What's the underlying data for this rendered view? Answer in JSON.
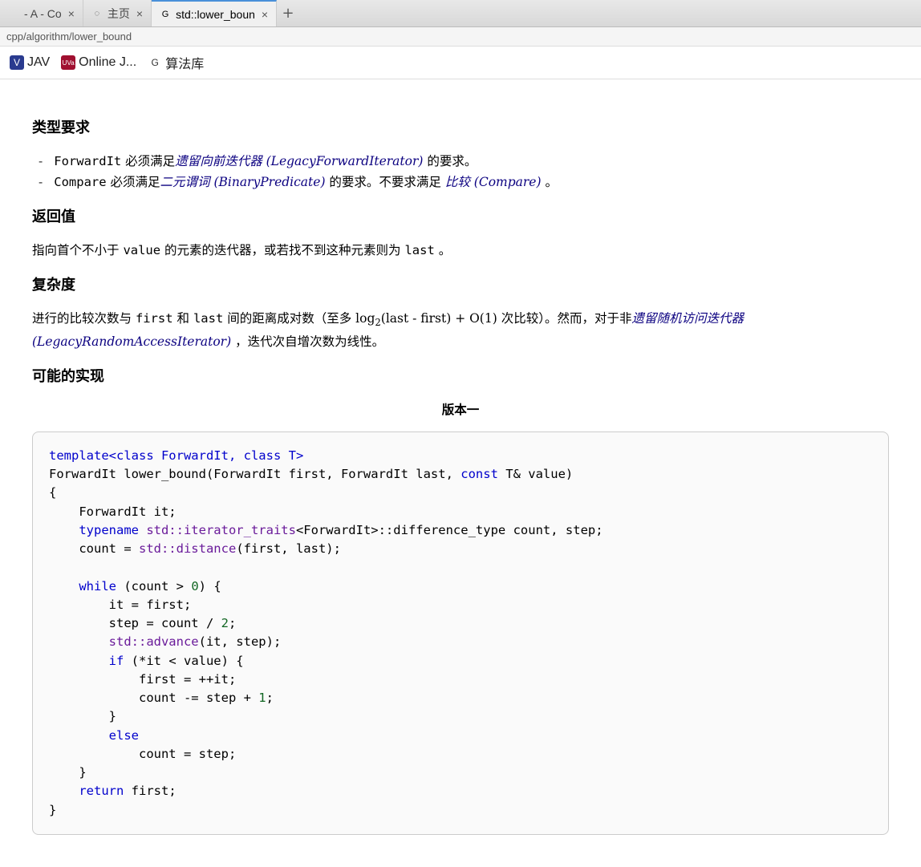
{
  "tabs": [
    {
      "label": "- A - Co",
      "favicon": ""
    },
    {
      "label": "主页",
      "favicon": "◌"
    },
    {
      "label": "std::lower_boun",
      "favicon": "G",
      "active": true
    }
  ],
  "url": "cpp/algorithm/lower_bound",
  "bookmarks": [
    {
      "label": "JAV",
      "icon_bg": "#2a3b8f",
      "icon_fg": "#fff",
      "icon_text": "V"
    },
    {
      "label": "Online J...",
      "icon_bg": "#a01030",
      "icon_fg": "#fff",
      "icon_text": "UVa"
    },
    {
      "label": "算法库",
      "icon_bg": "transparent",
      "icon_fg": "#333",
      "icon_text": "G"
    }
  ],
  "sections": {
    "type_req_title": "类型要求",
    "req1_prefix": "ForwardIt",
    "req1_text1": " 必须满足",
    "req1_link": "遗留向前迭代器 (LegacyForwardIterator)",
    "req1_text2": " 的要求。",
    "req2_prefix": "Compare",
    "req2_text1": " 必须满足",
    "req2_link1": "二元谓词 (BinaryPredicate)",
    "req2_text2": " 的要求。不要求满足 ",
    "req2_link2": "比较 (Compare)",
    "req2_text3": " 。",
    "return_title": "返回值",
    "return_text1": "指向首个不小于 ",
    "return_code1": "value",
    "return_text2": " 的元素的迭代器，或若找不到这种元素则为 ",
    "return_code2": "last",
    "return_text3": " 。",
    "complex_title": "复杂度",
    "complex_text1": "进行的比较次数与 ",
    "complex_code1": "first",
    "complex_text2": " 和 ",
    "complex_code2": "last",
    "complex_text3": " 间的距离成对数（至多 log",
    "complex_sub": "2",
    "complex_text4": "(last - first) + O(1) 次比较）。然而，对于非",
    "complex_link": "遗留随机访问迭代器 (LegacyRandomAccessIterator)",
    "complex_text5": " ，迭代次自增次数为线性。",
    "impl_title": "可能的实现",
    "impl_header": "版本一"
  },
  "code": {
    "l01": "template<class ForwardIt, class T>",
    "l02_a": "ForwardIt lower_bound",
    "l02_b": "(ForwardIt first, ForwardIt last, ",
    "l02_c": "const",
    "l02_d": " T& value)",
    "l03": "{",
    "l04": "    ForwardIt it;",
    "l05_a": "    ",
    "l05_b": "typename",
    "l05_c": " std::iterator_traits",
    "l05_d": "<ForwardIt>::",
    "l05_e": "difference_type count, step;",
    "l06_a": "    count = ",
    "l06_b": "std::distance",
    "l06_c": "(first, last);",
    "l07": " ",
    "l08_a": "    ",
    "l08_b": "while",
    "l08_c": " (count > ",
    "l08_d": "0",
    "l08_e": ") {",
    "l09": "        it = first;",
    "l10_a": "        step = count / ",
    "l10_b": "2",
    "l10_c": ";",
    "l11_a": "        ",
    "l11_b": "std::advance",
    "l11_c": "(it, step);",
    "l12_a": "        ",
    "l12_b": "if",
    "l12_c": " (*it < value) {",
    "l13": "            first = ++it;",
    "l14_a": "            count -= step + ",
    "l14_b": "1",
    "l14_c": ";",
    "l15": "        }",
    "l16_a": "        ",
    "l16_b": "else",
    "l17": "            count = step;",
    "l18": "    }",
    "l19_a": "    ",
    "l19_b": "return",
    "l19_c": " first;",
    "l20": "}"
  }
}
